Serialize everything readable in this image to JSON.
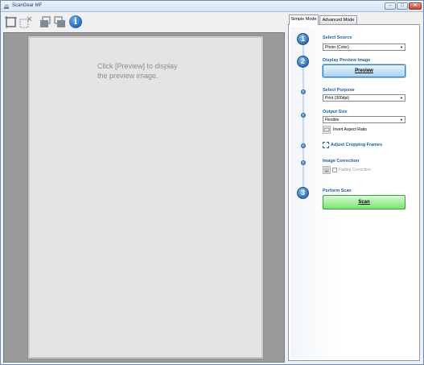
{
  "window": {
    "title": "ScanGear MF",
    "minimize_glyph": "–",
    "maximize_glyph": "□",
    "close_glyph": "✕"
  },
  "toolbar": {
    "icons": [
      "crop-frame-icon",
      "remove-crop-icon",
      "rotate-left-icon",
      "rotate-right-icon",
      "info-icon"
    ],
    "info_glyph": "i"
  },
  "preview": {
    "message": "Click [Preview] to display\nthe preview image."
  },
  "tabs": [
    {
      "label": "Simple Mode",
      "active": true
    },
    {
      "label": "Advanced Mode",
      "active": false
    }
  ],
  "steps": {
    "step1": {
      "number": "1",
      "label": "Select Source",
      "value": "Photo (Color)"
    },
    "step2": {
      "number": "2",
      "label": "Display Preview Image",
      "button": "Preview"
    },
    "purpose": {
      "label": "Select Purpose",
      "value": "Print (300dpi)"
    },
    "output": {
      "label": "Output Size",
      "value": "Flexible",
      "invert_label": "Invert Aspect Ratio"
    },
    "crop": {
      "label": "Adjust Cropping Frames"
    },
    "correction": {
      "label": "Image Correction",
      "fading_label": "Fading Correction"
    },
    "step3": {
      "number": "3",
      "label": "Perform Scan",
      "button": "Scan"
    }
  },
  "colors": {
    "accent": "#1e5fa8",
    "preview_button": "#a9d3f5",
    "scan_button": "#78e56f",
    "preview_bg": "#9a9a9a"
  }
}
